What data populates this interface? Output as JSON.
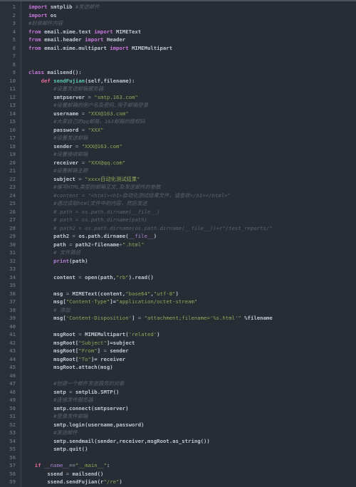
{
  "editor": {
    "title": "mailsend.py",
    "language": "Python",
    "theme": "dark",
    "colors": {
      "background": "#282c34",
      "gutter_background": "#2b2f38",
      "line_number": "#646b7a",
      "comment": "#5b6271",
      "keyword": "#c678dd",
      "keyword_alt": "#e06c9a",
      "string": "#8fa95a",
      "function": "#5fc9b0",
      "builtin": "#b07fd8",
      "text": "#abb2bf"
    },
    "total_lines": 59,
    "first_visible_line": 1,
    "last_visible_line": 59
  },
  "lines": [
    {
      "n": "1",
      "indent": 0,
      "tokens": [
        {
          "c": "kw",
          "t": "import"
        },
        {
          "c": "plain",
          "t": " smtplib "
        },
        {
          "c": "com",
          "t": "#发送邮件"
        }
      ]
    },
    {
      "n": "2",
      "indent": 0,
      "tokens": [
        {
          "c": "kw",
          "t": "import"
        },
        {
          "c": "plain",
          "t": " os"
        }
      ]
    },
    {
      "n": "3",
      "indent": 0,
      "tokens": [
        {
          "c": "com",
          "t": "#封装邮件内容"
        }
      ]
    },
    {
      "n": "4",
      "indent": 0,
      "tokens": [
        {
          "c": "kw",
          "t": "from"
        },
        {
          "c": "plain",
          "t": " email.mime.text "
        },
        {
          "c": "kw",
          "t": "import"
        },
        {
          "c": "plain",
          "t": " MIMEText"
        }
      ]
    },
    {
      "n": "5",
      "indent": 0,
      "tokens": [
        {
          "c": "kw",
          "t": "from"
        },
        {
          "c": "plain",
          "t": " email.header "
        },
        {
          "c": "kw",
          "t": "import"
        },
        {
          "c": "plain",
          "t": " Header"
        }
      ]
    },
    {
      "n": "6",
      "indent": 0,
      "tokens": [
        {
          "c": "kw",
          "t": "from"
        },
        {
          "c": "plain",
          "t": " email.mime.multipart "
        },
        {
          "c": "kw",
          "t": "import"
        },
        {
          "c": "plain",
          "t": " MIMEMultipart"
        }
      ]
    },
    {
      "n": "7",
      "indent": 0,
      "tokens": []
    },
    {
      "n": "8",
      "indent": 0,
      "tokens": []
    },
    {
      "n": "9",
      "indent": 0,
      "tokens": [
        {
          "c": "kw",
          "t": "class"
        },
        {
          "c": "plain",
          "t": " mailsend():"
        }
      ]
    },
    {
      "n": "10",
      "indent": 0,
      "tokens": [
        {
          "c": "plain",
          "t": "    "
        },
        {
          "c": "kw2",
          "t": "def"
        },
        {
          "c": "plain",
          "t": " "
        },
        {
          "c": "fn",
          "t": "sendFujian"
        },
        {
          "c": "plain",
          "t": "(self,filename):"
        }
      ]
    },
    {
      "n": "11",
      "indent": 0,
      "tokens": [
        {
          "c": "plain",
          "t": "        "
        },
        {
          "c": "com",
          "t": "#设置发送邮箱服务器"
        }
      ]
    },
    {
      "n": "12",
      "indent": 0,
      "tokens": [
        {
          "c": "plain",
          "t": "        smtpserver "
        },
        {
          "c": "op",
          "t": "= "
        },
        {
          "c": "str",
          "t": "\"smtp.163.com\""
        }
      ]
    },
    {
      "n": "13",
      "indent": 0,
      "tokens": [
        {
          "c": "plain",
          "t": "        "
        },
        {
          "c": "com",
          "t": "#设置邮箱的用户名及密码,用于邮箱登录"
        }
      ]
    },
    {
      "n": "14",
      "indent": 0,
      "tokens": [
        {
          "c": "plain",
          "t": "        username "
        },
        {
          "c": "op",
          "t": "= "
        },
        {
          "c": "str",
          "t": "\"XXX@163.com\""
        }
      ]
    },
    {
      "n": "15",
      "indent": 0,
      "tokens": [
        {
          "c": "plain",
          "t": "        "
        },
        {
          "c": "com",
          "t": "#大家自己的qq邮箱，163邮箱的授权码"
        }
      ]
    },
    {
      "n": "16",
      "indent": 0,
      "tokens": [
        {
          "c": "plain",
          "t": "        password "
        },
        {
          "c": "op",
          "t": "= "
        },
        {
          "c": "str",
          "t": "\"XXX\""
        }
      ]
    },
    {
      "n": "17",
      "indent": 0,
      "tokens": [
        {
          "c": "plain",
          "t": "        "
        },
        {
          "c": "com",
          "t": "#设置发送邮箱"
        }
      ]
    },
    {
      "n": "18",
      "indent": 0,
      "tokens": [
        {
          "c": "plain",
          "t": "        sender "
        },
        {
          "c": "op",
          "t": "= "
        },
        {
          "c": "str",
          "t": "\"XXX@163.com\""
        }
      ]
    },
    {
      "n": "19",
      "indent": 0,
      "tokens": [
        {
          "c": "plain",
          "t": "        "
        },
        {
          "c": "com",
          "t": "#设置接收邮箱"
        }
      ]
    },
    {
      "n": "20",
      "indent": 0,
      "tokens": [
        {
          "c": "plain",
          "t": "        receiver "
        },
        {
          "c": "op",
          "t": "= "
        },
        {
          "c": "str",
          "t": "\"XXX@qq.com\""
        }
      ]
    },
    {
      "n": "21",
      "indent": 0,
      "tokens": [
        {
          "c": "plain",
          "t": "        "
        },
        {
          "c": "com",
          "t": "#设置邮箱主题"
        }
      ]
    },
    {
      "n": "22",
      "indent": 0,
      "tokens": [
        {
          "c": "plain",
          "t": "        subject "
        },
        {
          "c": "op",
          "t": "= "
        },
        {
          "c": "str",
          "t": "\"xxxx自动化测试结果\""
        }
      ]
    },
    {
      "n": "23",
      "indent": 0,
      "tokens": [
        {
          "c": "plain",
          "t": "        "
        },
        {
          "c": "com",
          "t": "#编写HTML类型的邮箱正文,及发送邮件的参数"
        }
      ]
    },
    {
      "n": "24",
      "indent": 0,
      "tokens": [
        {
          "c": "plain",
          "t": "        "
        },
        {
          "c": "com",
          "t": "#content = \"<html><h1>自动化测试结果文件，请查收</h1></html>\""
        }
      ]
    },
    {
      "n": "25",
      "indent": 0,
      "tokens": [
        {
          "c": "plain",
          "t": "        "
        },
        {
          "c": "com",
          "t": "#通过读取html文件中的内容，然后发送"
        }
      ]
    },
    {
      "n": "26",
      "indent": 0,
      "tokens": [
        {
          "c": "plain",
          "t": "        "
        },
        {
          "c": "com",
          "t": "# path = os.path.dirname(__file__)"
        }
      ]
    },
    {
      "n": "27",
      "indent": 0,
      "tokens": [
        {
          "c": "plain",
          "t": "        "
        },
        {
          "c": "com",
          "t": "# path = os.path.dirname(path)"
        }
      ]
    },
    {
      "n": "28",
      "indent": 0,
      "tokens": [
        {
          "c": "plain",
          "t": "        "
        },
        {
          "c": "com",
          "t": "# path2 = os.path.dirname(os.path.dirname(__file__))+r\"/test_reports/\""
        }
      ]
    },
    {
      "n": "29",
      "indent": 0,
      "tokens": [
        {
          "c": "plain",
          "t": "        path2 "
        },
        {
          "c": "op",
          "t": "= "
        },
        {
          "c": "plain",
          "t": "os.path.dirname("
        },
        {
          "c": "dun",
          "t": "__file__"
        },
        {
          "c": "plain",
          "t": ")"
        }
      ]
    },
    {
      "n": "30",
      "indent": 0,
      "tokens": [
        {
          "c": "plain",
          "t": "        path "
        },
        {
          "c": "op",
          "t": "= "
        },
        {
          "c": "plain",
          "t": "path2"
        },
        {
          "c": "op",
          "t": "+"
        },
        {
          "c": "plain",
          "t": "filename"
        },
        {
          "c": "op",
          "t": "+"
        },
        {
          "c": "str",
          "t": "\".html\""
        }
      ]
    },
    {
      "n": "31",
      "indent": 0,
      "tokens": [
        {
          "c": "plain",
          "t": "        "
        },
        {
          "c": "com",
          "t": "# 文件路径"
        }
      ]
    },
    {
      "n": "32",
      "indent": 0,
      "tokens": [
        {
          "c": "plain",
          "t": "        "
        },
        {
          "c": "bi",
          "t": "print"
        },
        {
          "c": "plain",
          "t": "(path)"
        }
      ]
    },
    {
      "n": "33",
      "indent": 0,
      "tokens": []
    },
    {
      "n": "34",
      "indent": 0,
      "tokens": [
        {
          "c": "plain",
          "t": "        content "
        },
        {
          "c": "op",
          "t": "= "
        },
        {
          "c": "plain",
          "t": "open(path,"
        },
        {
          "c": "str",
          "t": "\"rb\""
        },
        {
          "c": "plain",
          "t": ").read()"
        }
      ]
    },
    {
      "n": "35",
      "indent": 0,
      "tokens": []
    },
    {
      "n": "36",
      "indent": 0,
      "tokens": [
        {
          "c": "plain",
          "t": "        msg "
        },
        {
          "c": "op",
          "t": "= "
        },
        {
          "c": "plain",
          "t": "MIMEText(content,"
        },
        {
          "c": "str",
          "t": "\"base64\""
        },
        {
          "c": "plain",
          "t": ","
        },
        {
          "c": "str",
          "t": "\"utf-8\""
        },
        {
          "c": "plain",
          "t": ")"
        }
      ]
    },
    {
      "n": "37",
      "indent": 0,
      "tokens": [
        {
          "c": "plain",
          "t": "        msg["
        },
        {
          "c": "str",
          "t": "\"Content-Type\""
        },
        {
          "c": "plain",
          "t": "]="
        },
        {
          "c": "str",
          "t": "\"application/octet-stream\""
        }
      ]
    },
    {
      "n": "38",
      "indent": 0,
      "tokens": [
        {
          "c": "plain",
          "t": "        "
        },
        {
          "c": "com",
          "t": "# 添加"
        }
      ]
    },
    {
      "n": "39",
      "indent": 0,
      "tokens": [
        {
          "c": "plain",
          "t": "        msg["
        },
        {
          "c": "str",
          "t": "'Content-Disposition'"
        },
        {
          "c": "plain",
          "t": "] "
        },
        {
          "c": "op",
          "t": "= "
        },
        {
          "c": "str",
          "t": "\"attachment;filename='%s.html'\""
        },
        {
          "c": "plain",
          "t": " %filename"
        }
      ]
    },
    {
      "n": "40",
      "indent": 0,
      "tokens": []
    },
    {
      "n": "41",
      "indent": 0,
      "tokens": [
        {
          "c": "plain",
          "t": "        msgRoot "
        },
        {
          "c": "op",
          "t": "= "
        },
        {
          "c": "plain",
          "t": "MIMEMultipart("
        },
        {
          "c": "str",
          "t": "'related'"
        },
        {
          "c": "plain",
          "t": ")"
        }
      ]
    },
    {
      "n": "42",
      "indent": 0,
      "tokens": [
        {
          "c": "plain",
          "t": "        msgRoot["
        },
        {
          "c": "str",
          "t": "\"Subject\""
        },
        {
          "c": "plain",
          "t": "]=subject"
        }
      ]
    },
    {
      "n": "43",
      "indent": 0,
      "tokens": [
        {
          "c": "plain",
          "t": "        msgRoot["
        },
        {
          "c": "str",
          "t": "\"From\""
        },
        {
          "c": "plain",
          "t": "] "
        },
        {
          "c": "op",
          "t": "= "
        },
        {
          "c": "plain",
          "t": "sender"
        }
      ]
    },
    {
      "n": "44",
      "indent": 0,
      "tokens": [
        {
          "c": "plain",
          "t": "        msgRoot["
        },
        {
          "c": "str",
          "t": "\"To\""
        },
        {
          "c": "plain",
          "t": "]= receiver"
        }
      ]
    },
    {
      "n": "45",
      "indent": 0,
      "tokens": [
        {
          "c": "plain",
          "t": "        msgRoot.attach(msg)"
        }
      ]
    },
    {
      "n": "46",
      "indent": 0,
      "tokens": []
    },
    {
      "n": "47",
      "indent": 0,
      "tokens": [
        {
          "c": "plain",
          "t": "        "
        },
        {
          "c": "com",
          "t": "#创建一个邮件发送服务的对象"
        }
      ]
    },
    {
      "n": "48",
      "indent": 0,
      "tokens": [
        {
          "c": "plain",
          "t": "        smtp "
        },
        {
          "c": "op",
          "t": "= "
        },
        {
          "c": "plain",
          "t": "smtplib.SMTP()"
        }
      ]
    },
    {
      "n": "49",
      "indent": 0,
      "tokens": [
        {
          "c": "plain",
          "t": "        "
        },
        {
          "c": "com",
          "t": "#连接发件服务器"
        }
      ]
    },
    {
      "n": "50",
      "indent": 0,
      "tokens": [
        {
          "c": "plain",
          "t": "        smtp.connect(smtpserver)"
        }
      ]
    },
    {
      "n": "51",
      "indent": 0,
      "tokens": [
        {
          "c": "plain",
          "t": "        "
        },
        {
          "c": "com",
          "t": "#登录发件邮箱"
        }
      ]
    },
    {
      "n": "52",
      "indent": 0,
      "tokens": [
        {
          "c": "plain",
          "t": "        smtp.login(username,password)"
        }
      ]
    },
    {
      "n": "53",
      "indent": 0,
      "tokens": [
        {
          "c": "plain",
          "t": "        "
        },
        {
          "c": "com",
          "t": "#发送邮件"
        }
      ]
    },
    {
      "n": "54",
      "indent": 0,
      "tokens": [
        {
          "c": "plain",
          "t": "        smtp.sendmail(sender,receiver,msgRoot.as_string())"
        }
      ]
    },
    {
      "n": "55",
      "indent": 0,
      "tokens": [
        {
          "c": "plain",
          "t": "        smtp.quit()"
        }
      ]
    },
    {
      "n": "56",
      "indent": 0,
      "tokens": []
    },
    {
      "n": "57",
      "indent": 0,
      "tokens": [
        {
          "c": "plain",
          "t": "  "
        },
        {
          "c": "kw2",
          "t": "if"
        },
        {
          "c": "plain",
          "t": " "
        },
        {
          "c": "dun",
          "t": "__name__"
        },
        {
          "c": "op",
          "t": "=="
        },
        {
          "c": "str",
          "t": "\"__main__\""
        },
        {
          "c": "plain",
          "t": ":"
        }
      ]
    },
    {
      "n": "58",
      "indent": 0,
      "tokens": [
        {
          "c": "plain",
          "t": "      ssend "
        },
        {
          "c": "op",
          "t": "= "
        },
        {
          "c": "plain",
          "t": "mailsend()"
        }
      ]
    },
    {
      "n": "59",
      "indent": 0,
      "tokens": [
        {
          "c": "plain",
          "t": "      ssend.sendFujian(r"
        },
        {
          "c": "str",
          "t": "\"/re\""
        },
        {
          "c": "plain",
          "t": ")"
        }
      ]
    }
  ]
}
